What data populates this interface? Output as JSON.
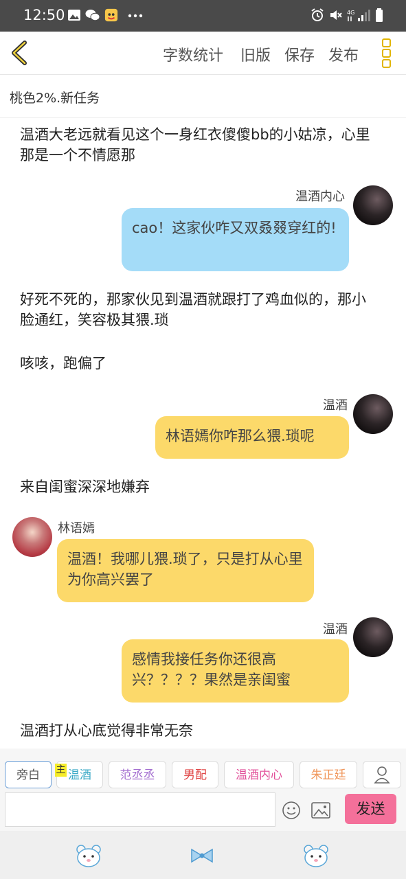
{
  "status": {
    "time": "12:50"
  },
  "toolbar": {
    "word_count": "字数统计",
    "old_version": "旧版",
    "save": "保存",
    "publish": "发布"
  },
  "chapter_title": "桃色2%.新任务",
  "messages": {
    "n1": "温酒大老远就看见这个一身红衣傻傻bb的小姑凉，心里那是一个不情愿那",
    "m1_name": "温酒内心",
    "m1_text": "cao！这家伙咋又双叒叕穿红的!",
    "n2": "好死不死的，那家伙见到温酒就跟打了鸡血似的，那小脸通红，笑容极其猥.琐",
    "n3": "咳咳，跑偏了",
    "m2_name": "温酒",
    "m2_text": "林语嫣你咋那么猥.琐呢",
    "n4": "来自闺蜜深深地嫌弃",
    "m3_name": "林语嫣",
    "m3_text": "温酒！我哪儿猥.琐了，只是打从心里为你高兴罢了",
    "m4_name": "温酒",
    "m4_text": "感情我接任务你还很高兴？？？？果然是亲闺蜜",
    "n5": "温酒打从心底觉得非常无奈"
  },
  "roles": {
    "narration": "旁白",
    "main_marker": "主",
    "r1": "温酒",
    "r2": "范丞丞",
    "r3": "男配",
    "r4": "温酒内心",
    "r5": "朱正廷"
  },
  "colors": {
    "r1": "#3aa9c6",
    "r2": "#a46fd0",
    "r3": "#e04848",
    "r4": "#e2509a",
    "r5": "#f0965a"
  },
  "send_label": "发送"
}
